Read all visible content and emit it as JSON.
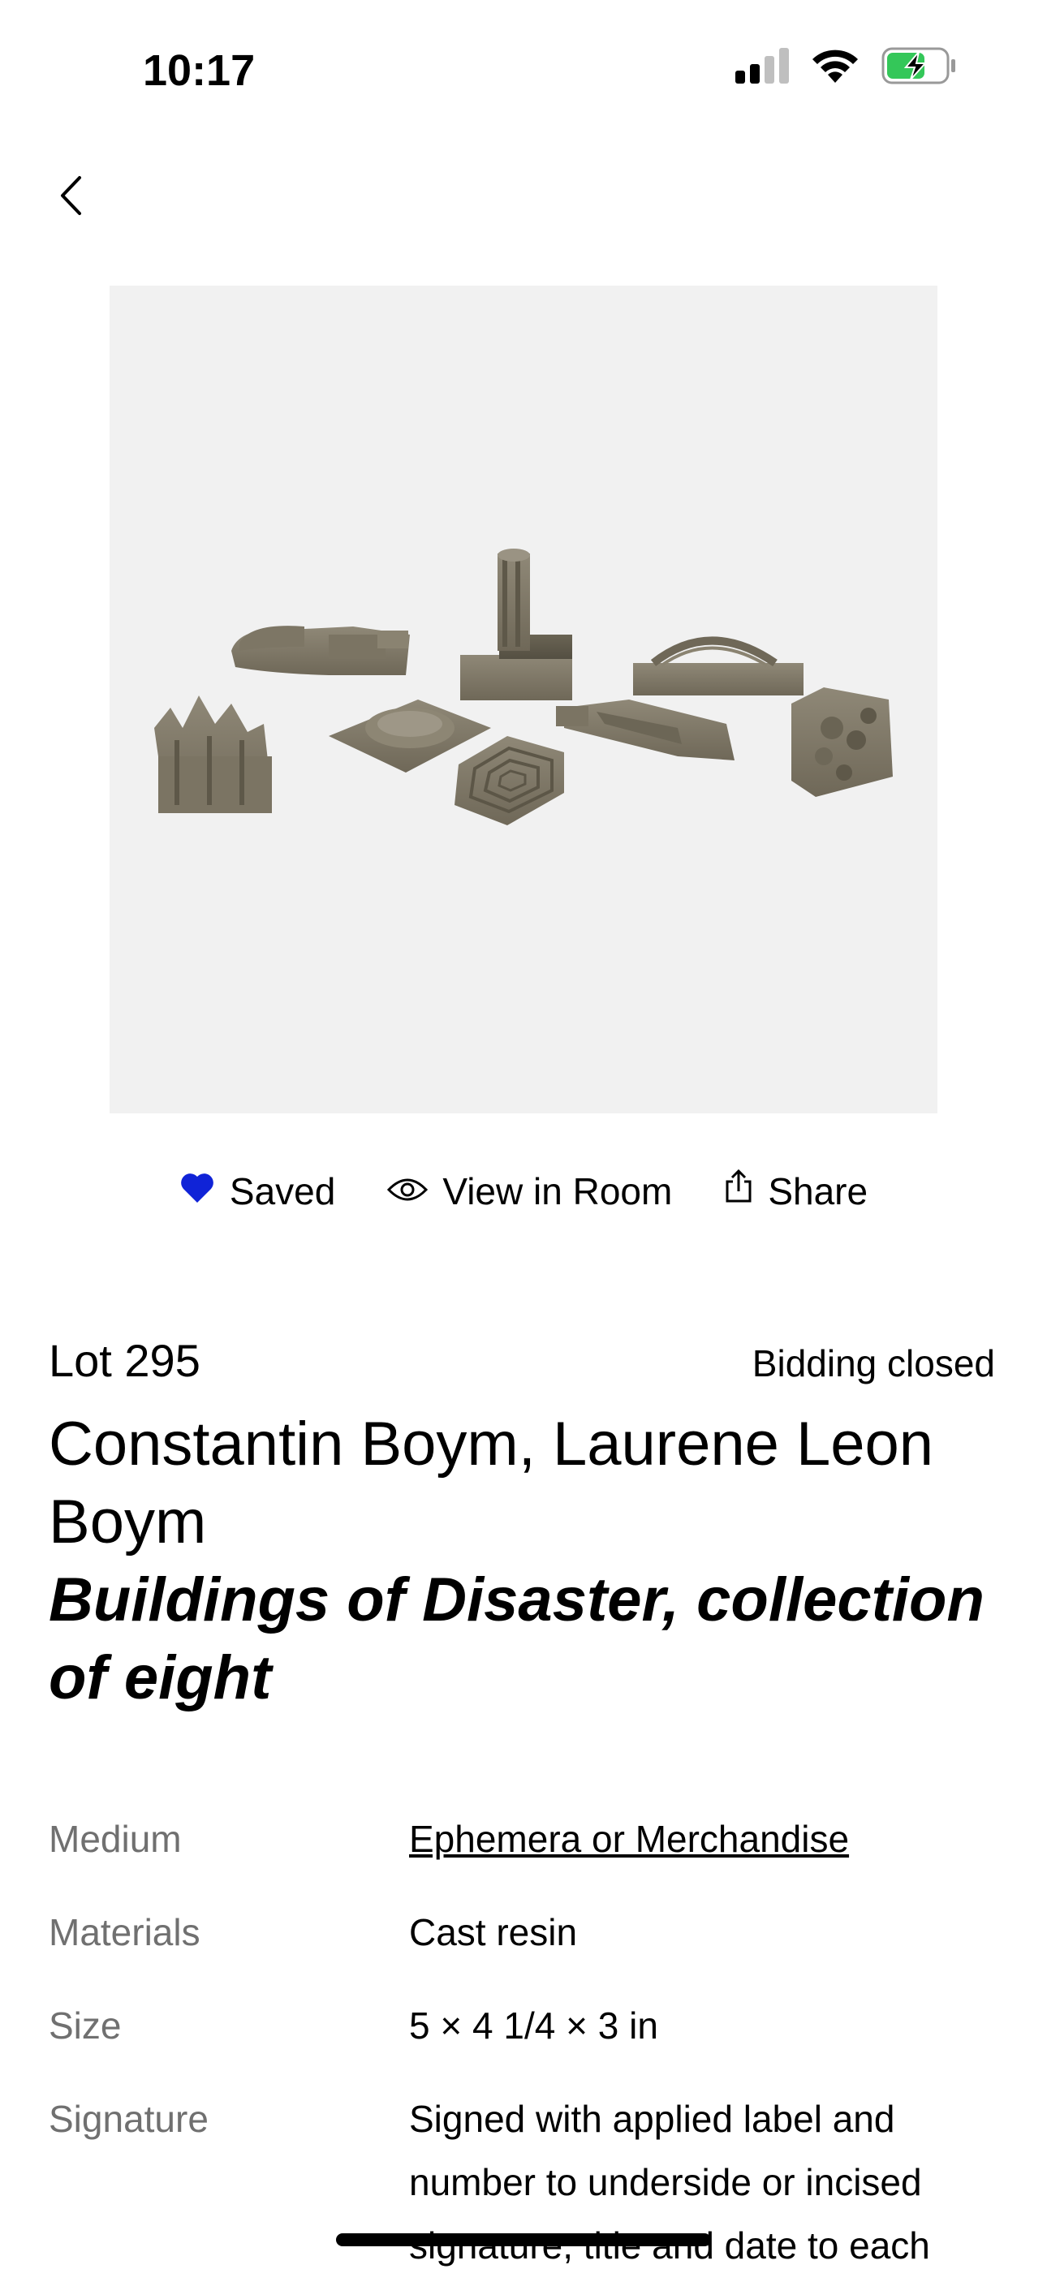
{
  "status_bar": {
    "time": "10:17",
    "icons": [
      "cellular-signal-icon",
      "wifi-icon",
      "battery-charging-icon"
    ]
  },
  "nav": {
    "back_icon": "chevron-left-icon"
  },
  "actions": {
    "saved_label": "Saved",
    "view_in_room_label": "View in Room",
    "share_label": "Share",
    "saved_icon_color": "#1023d7"
  },
  "lot": {
    "number": "Lot 295",
    "status": "Bidding closed",
    "artist": "Constantin Boym, Laurene Leon Boym",
    "title": "Buildings of Disaster, collection of eight"
  },
  "details": [
    {
      "label": "Medium",
      "value": "Ephemera or Merchandise",
      "link": true
    },
    {
      "label": "Materials",
      "value": "Cast resin",
      "link": false
    },
    {
      "label": "Size",
      "value": "5 × 4 1/4 × 3 in",
      "link": false
    },
    {
      "label": "Signature",
      "value": "Signed with applied label and number to underside or incised signature, title and date to each",
      "link": false
    }
  ]
}
